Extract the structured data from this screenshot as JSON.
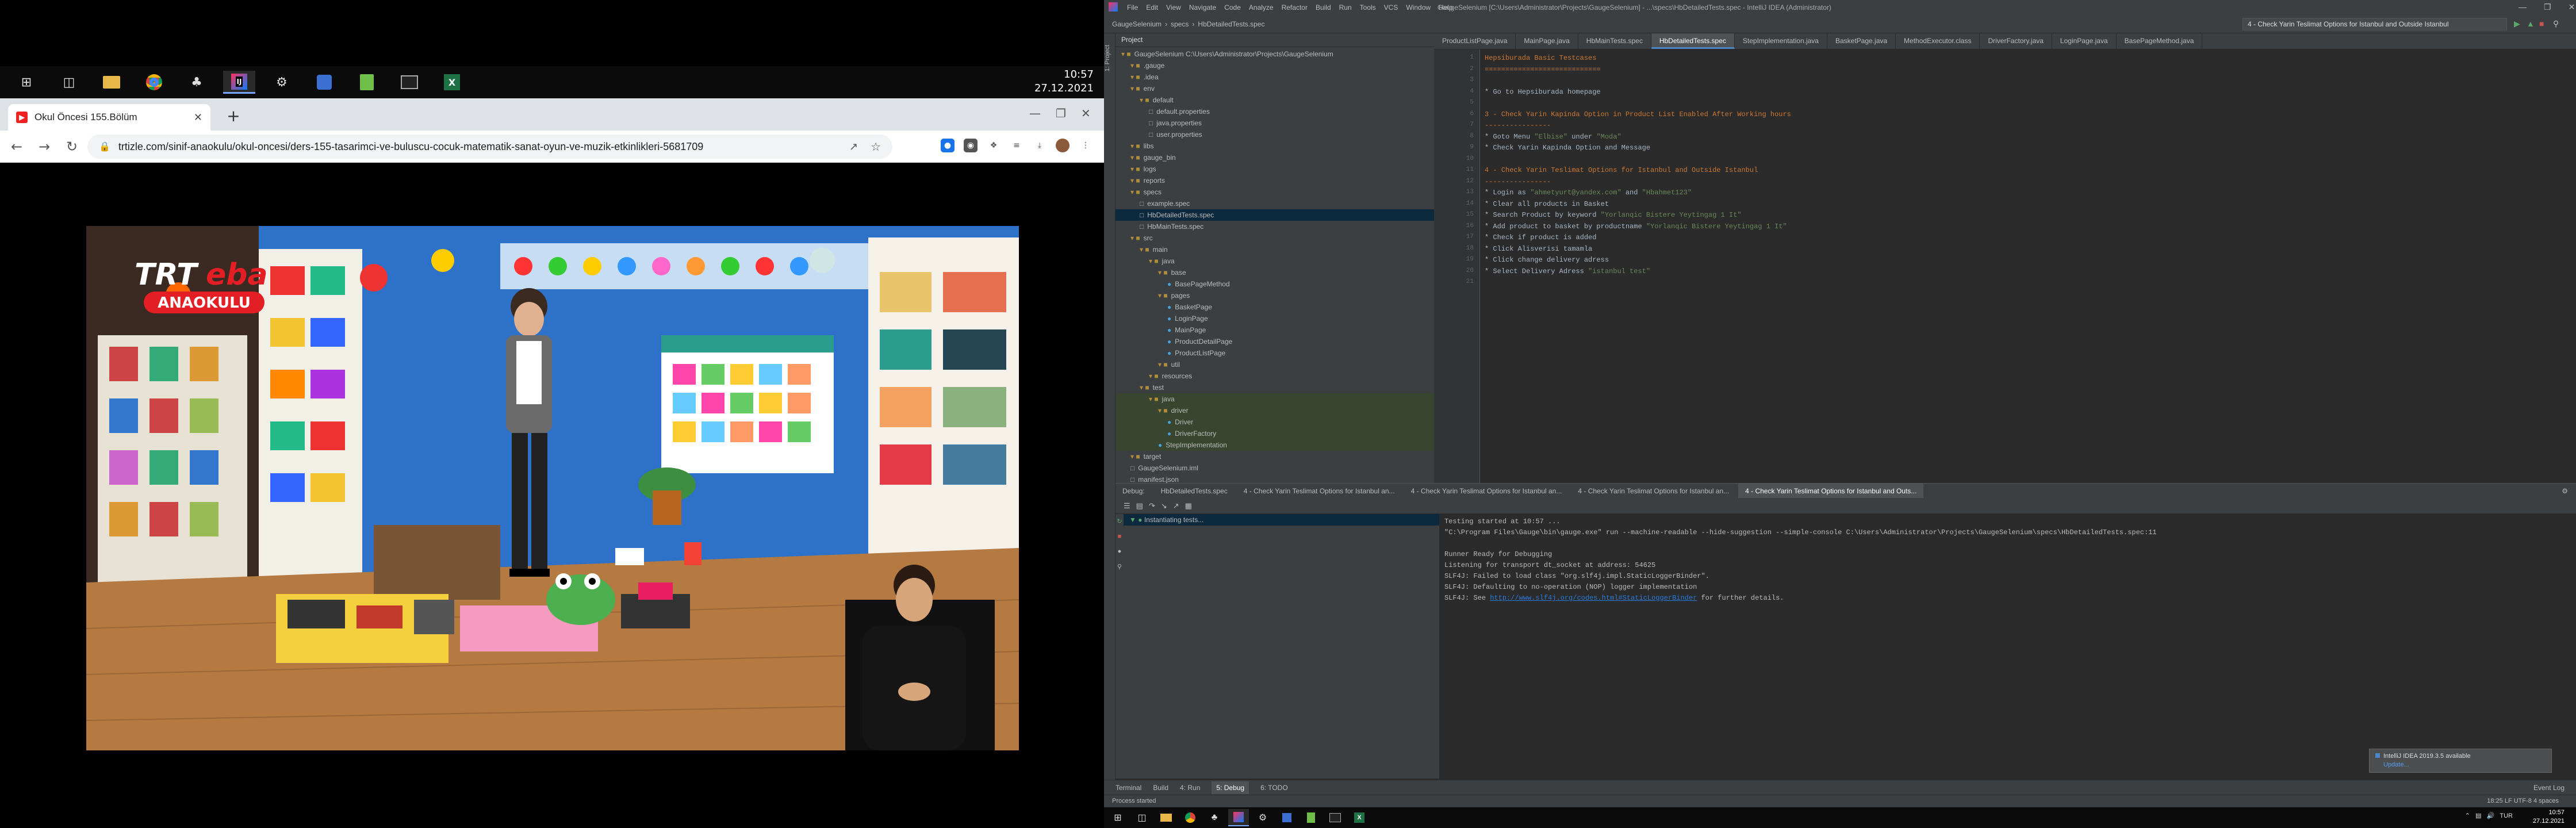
{
  "left_screen": {
    "taskbar": {
      "icons": [
        "windows-logo-icon",
        "task-view-icon",
        "file-explorer-icon",
        "chrome-icon",
        "app-icon",
        "intellij-icon",
        "settings-icon",
        "remote-icon",
        "notepad-icon",
        "terminal-icon",
        "excel-icon"
      ],
      "time": "10:57",
      "date": "27.12.2021"
    },
    "browser": {
      "tab_title": "Okul Öncesi 155.Bölüm",
      "url": "trtizle.com/sinif-anaokulu/okul-oncesi/ders-155-tasarimci-ve-buluscu-cocuk-matematik-sanat-oyun-ve-muzik-etkinlikleri-5681709",
      "video": {
        "logo_top": "TRT",
        "logo_accent": "eba",
        "logo_bottom": "ANAOKULU"
      }
    }
  },
  "ide": {
    "menu": [
      "File",
      "Edit",
      "View",
      "Navigate",
      "Code",
      "Analyze",
      "Refactor",
      "Build",
      "Run",
      "Tools",
      "VCS",
      "Window",
      "Help"
    ],
    "title": "GaugeSelenium [C:\\Users\\Administrator\\Projects\\GaugeSelenium] - ...\\specs\\HbDetailedTests.spec - IntelliJ IDEA (Administrator)",
    "breadcrumb": [
      "GaugeSelenium",
      "specs",
      "HbDetailedTests.spec"
    ],
    "run_config": "4 - Check Yarin Teslimat Options for Istanbul and Outside Istanbul",
    "project": {
      "header": "Project",
      "tree": [
        {
          "indent": 0,
          "label": "GaugeSelenium  C:\\Users\\Administrator\\Projects\\GaugeSelenium",
          "type": "dir"
        },
        {
          "indent": 1,
          "label": ".gauge",
          "type": "dir"
        },
        {
          "indent": 1,
          "label": ".idea",
          "type": "dir"
        },
        {
          "indent": 1,
          "label": "env",
          "type": "dir"
        },
        {
          "indent": 2,
          "label": "default",
          "type": "dir"
        },
        {
          "indent": 3,
          "label": "default.properties",
          "type": "file"
        },
        {
          "indent": 3,
          "label": "java.properties",
          "type": "file"
        },
        {
          "indent": 3,
          "label": "user.properties",
          "type": "file"
        },
        {
          "indent": 1,
          "label": "libs",
          "type": "dir"
        },
        {
          "indent": 1,
          "label": "gauge_bin",
          "type": "dir"
        },
        {
          "indent": 1,
          "label": "logs",
          "type": "dir"
        },
        {
          "indent": 1,
          "label": "reports",
          "type": "dir"
        },
        {
          "indent": 1,
          "label": "specs",
          "type": "dir"
        },
        {
          "indent": 2,
          "label": "example.spec",
          "type": "file"
        },
        {
          "indent": 2,
          "label": "HbDetailedTests.spec",
          "type": "file",
          "sel": true
        },
        {
          "indent": 2,
          "label": "HbMainTests.spec",
          "type": "file"
        },
        {
          "indent": 1,
          "label": "src",
          "type": "dir"
        },
        {
          "indent": 2,
          "label": "main",
          "type": "dir"
        },
        {
          "indent": 3,
          "label": "java",
          "type": "dir"
        },
        {
          "indent": 4,
          "label": "base",
          "type": "dir"
        },
        {
          "indent": 5,
          "label": "BasePageMethod",
          "type": "java"
        },
        {
          "indent": 4,
          "label": "pages",
          "type": "dir"
        },
        {
          "indent": 5,
          "label": "BasketPage",
          "type": "java"
        },
        {
          "indent": 5,
          "label": "LoginPage",
          "type": "java"
        },
        {
          "indent": 5,
          "label": "MainPage",
          "type": "java"
        },
        {
          "indent": 5,
          "label": "ProductDetailPage",
          "type": "java"
        },
        {
          "indent": 5,
          "label": "ProductListPage",
          "type": "java"
        },
        {
          "indent": 4,
          "label": "util",
          "type": "dir"
        },
        {
          "indent": 3,
          "label": "resources",
          "type": "dir"
        },
        {
          "indent": 2,
          "label": "test",
          "type": "dir"
        },
        {
          "indent": 3,
          "label": "java",
          "type": "dir",
          "grn": true
        },
        {
          "indent": 4,
          "label": "driver",
          "type": "dir",
          "grn": true
        },
        {
          "indent": 5,
          "label": "Driver",
          "type": "java",
          "grn": true
        },
        {
          "indent": 5,
          "label": "DriverFactory",
          "type": "java",
          "grn": true
        },
        {
          "indent": 4,
          "label": "StepImplementation",
          "type": "java",
          "grn": true
        },
        {
          "indent": 1,
          "label": "target",
          "type": "dir"
        },
        {
          "indent": 1,
          "label": "GaugeSelenium.iml",
          "type": "file"
        },
        {
          "indent": 1,
          "label": "manifest.json",
          "type": "file"
        }
      ]
    },
    "editor_tabs": [
      "ProductListPage.java",
      "MainPage.java",
      "HbMainTests.spec",
      "HbDetailedTests.spec",
      "StepImplementation.java",
      "BasketPage.java",
      "MethodExecutor.class",
      "DriverFactory.java",
      "LoginPage.java",
      "BasePageMethod.java"
    ],
    "active_tab": 3,
    "code_lines": [
      {
        "t": "Hepsiburada Basic Testcases",
        "k": "h"
      },
      {
        "t": "============================",
        "k": "h"
      },
      {
        "t": "",
        "k": ""
      },
      {
        "t": "* Go to Hepsiburada homepage",
        "k": ""
      },
      {
        "t": "",
        "k": ""
      },
      {
        "t": "3 - Check Yarin Kapinda Option in Product List Enabled After Working hours",
        "k": "h"
      },
      {
        "t": "----------------",
        "k": "h"
      },
      {
        "t": "* Goto Menu \"Elbise\" under \"Moda\"",
        "k": ""
      },
      {
        "t": "* Check Yarin Kapinda Option and Message",
        "k": ""
      },
      {
        "t": "",
        "k": ""
      },
      {
        "t": "4 - Check Yarin Teslimat Options for Istanbul and Outside Istanbul",
        "k": "h"
      },
      {
        "t": "----------------",
        "k": "h"
      },
      {
        "t": "* Login as \"ahmetyurt@yandex.com\" and \"Hbahmet123\"",
        "k": ""
      },
      {
        "t": "* Clear all products in Basket",
        "k": ""
      },
      {
        "t": "* Search Product by keyword \"Yorlanqic Bistere Yeytingag 1 It\"",
        "k": ""
      },
      {
        "t": "* Add product to basket by productname \"Yorlanqic Bistere Yeytingag 1 It\"",
        "k": ""
      },
      {
        "t": "* Check if product is added",
        "k": ""
      },
      {
        "t": "* Click Alisverisi tamamla",
        "k": ""
      },
      {
        "t": "* Click change delivery adress",
        "k": ""
      },
      {
        "t": "* Select Delivery Adress \"istanbul test\"",
        "k": ""
      },
      {
        "t": "",
        "k": ""
      }
    ],
    "debug": {
      "label": "Debug:",
      "tabs": [
        "HbDetailedTests.spec",
        "4 - Check Yarin Teslimat Options for Istanbul an...",
        "4 - Check Yarin Teslimat Options for Istanbul an...",
        "4 - Check Yarin Teslimat Options for Istanbul an...",
        "4 - Check Yarin Teslimat Options for Istanbul and Outs..."
      ],
      "frame_status": "Instantiating tests...",
      "console_lines": [
        "Testing started at 10:57 ...",
        "\"C:\\Program Files\\Gauge\\bin\\gauge.exe\" run --machine-readable --hide-suggestion --simple-console C:\\Users\\Administrator\\Projects\\GaugeSelenium\\specs\\HbDetailedTests.spec:11",
        "",
        "Runner Ready for Debugging",
        "Listening for transport dt_socket at address: 54625",
        "SLF4J: Failed to load class \"org.slf4j.impl.StaticLoggerBinder\".",
        "SLF4J: Defaulting to no-operation (NOP) logger implementation"
      ],
      "console_link_prefix": "SLF4J: See ",
      "console_link": "http://www.slf4j.org/codes.html#StaticLoggerBinder",
      "console_link_suffix": " for further details."
    },
    "notification": {
      "title": "IntelliJ IDEA 2019.3.5 available",
      "action": "Update..."
    },
    "bottom_tools": [
      "Terminal",
      "Build",
      "4: Run",
      "5: Debug",
      "6: TODO"
    ],
    "event_log": "Event Log",
    "status_left": "Process started",
    "status_right": "18:25   LF   UTF-8   4 spaces",
    "taskbar": {
      "time": "10:57",
      "date": "27.12.2021",
      "lang": "TUR"
    }
  }
}
